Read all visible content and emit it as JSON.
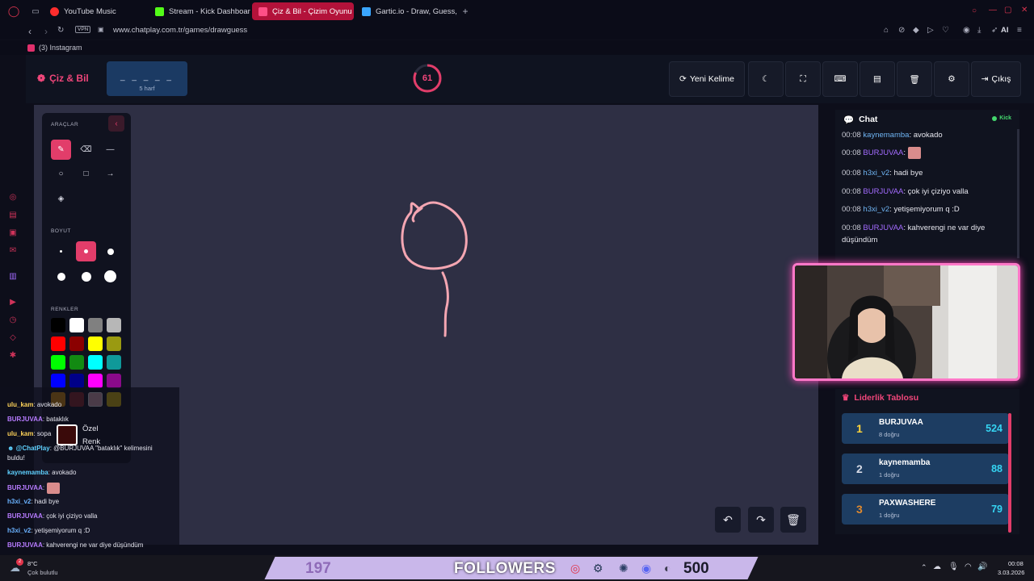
{
  "browser": {
    "tabs": [
      {
        "label": "YouTube Music",
        "color": "#ff2d2d",
        "active": false
      },
      {
        "label": "Stream - Kick Dashboard",
        "color": "#53fc18",
        "active": false
      },
      {
        "label": "Çiz & Bil - Çizim Oyunu",
        "color": "#ff4f86",
        "active": true
      },
      {
        "label": "Gartic.io - Draw, Guess, W",
        "color": "#3aa6ff",
        "active": false
      }
    ],
    "vpn_label": "VPN",
    "url": "www.chatplay.com.tr/games/drawguess",
    "ai_label": "AI",
    "bookmark": "(3) Instagram"
  },
  "game": {
    "logo": "Çiz & Bil",
    "word_mask": "_ _ _ _ _",
    "word_hint": "5 harf",
    "timer": "61",
    "timer_fraction": 0.82,
    "new_word_label": "Yeni Kelime",
    "exit_label": "Çıkış",
    "accent": "#e23d6a"
  },
  "tools": {
    "title": "ARAÇLAR",
    "size_title": "BOYUT",
    "colors_title": "RENKLER",
    "colors": [
      "#000000",
      "#ffffff",
      "#808080",
      "#b7b7b7",
      "#ff0000",
      "#8b0000",
      "#ffff00",
      "#9a9a11",
      "#00ff00",
      "#128a12",
      "#00ffff",
      "#0f9999",
      "#0000ff",
      "#000088",
      "#ff00ff",
      "#8a0a8a",
      "#ffa500",
      "#a52a2a",
      "#ffc0cb",
      "#ffd700"
    ],
    "custom_label": "Özel Renk",
    "custom_color": "#3a0a0a"
  },
  "chat": {
    "title": "Chat",
    "platform": "Kick",
    "messages": [
      {
        "time": "00:08",
        "user": "kaynemamba",
        "text": ": avokado"
      },
      {
        "time": "00:08",
        "user": "BURJUVAA",
        "text": ":"
      },
      {
        "time": "00:08",
        "user": "h3xi_v2",
        "text": ": hadi bye"
      },
      {
        "time": "00:08",
        "user": "BURJUVAA",
        "text": ": çok iyi çiziyo valla"
      },
      {
        "time": "00:08",
        "user": "h3xi_v2",
        "text": ": yetişemiyorum q :D"
      },
      {
        "time": "00:08",
        "user": "BURJUVAA",
        "text": ": kahverengi ne var diye düşündüm"
      }
    ]
  },
  "leaderboard": {
    "title": "Liderlik Tablosu",
    "rows": [
      {
        "rank": "1",
        "name": "BURJUVAA",
        "sub": "8 doğru",
        "score": "524",
        "rank_color": "#ffd43b"
      },
      {
        "rank": "2",
        "name": "kaynemamba",
        "sub": "1 doğru",
        "score": "88",
        "rank_color": "#d7dbe6"
      },
      {
        "rank": "3",
        "name": "PAXWASHERE",
        "sub": "1 doğru",
        "score": "79",
        "rank_color": "#e08a2e"
      }
    ]
  },
  "overlay_chat": {
    "messages": [
      {
        "user": "ulu_kam",
        "text": ": avokado"
      },
      {
        "user": "BURJUVAA",
        "text": ": bataklık"
      },
      {
        "user": "ulu_kam",
        "text": ": sopa"
      },
      {
        "user": "@ChatPlay",
        "text": ": @BURJUVAA \"bataklık\" kelimesini buldu!"
      },
      {
        "user": "kaynemamba",
        "text": ": avokado"
      },
      {
        "user": "BURJUVAA",
        "text": ":"
      },
      {
        "user": "h3xi_v2",
        "text": ": hadi bye"
      },
      {
        "user": "BURJUVAA",
        "text": ": çok iyi çiziyo valla"
      },
      {
        "user": "h3xi_v2",
        "text": ": yetişemiyorum q :D"
      },
      {
        "user": "BURJUVAA",
        "text": ": kahverengi ne var diye düşündüm"
      }
    ]
  },
  "taskbar": {
    "weather_temp": "8°C",
    "weather_desc": "Çok bulutlu",
    "notif_badge": "2",
    "followers_current": "197",
    "followers_label": "FOLLOWERS",
    "followers_goal": "500",
    "clock_time": "00:08",
    "clock_date": "3.03.2026"
  }
}
